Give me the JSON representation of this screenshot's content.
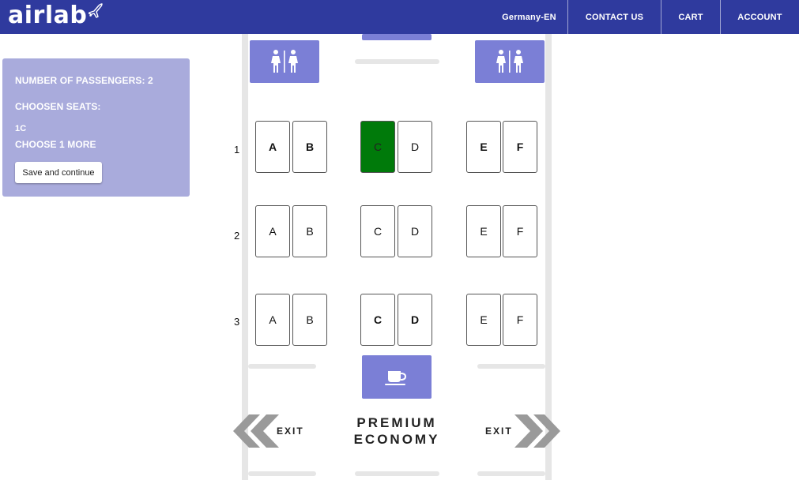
{
  "header": {
    "logo": "airlab",
    "nav": {
      "language": "Germany-EN",
      "contact": "CONTACT US",
      "cart": "CART",
      "account": "ACCOUNT"
    }
  },
  "panel": {
    "passengers": "NUMBER OF PASSENGERS: 2",
    "chosen_label": "CHOOSEN SEATS:",
    "chosen_seat": "1C",
    "choose_more": "CHOOSE 1 MORE",
    "save_button": "Save and continue"
  },
  "seat_map": {
    "rows": [
      {
        "number": "1",
        "seats": [
          "A",
          "B",
          "C",
          "D",
          "E",
          "F"
        ]
      },
      {
        "number": "2",
        "seats": [
          "A",
          "B",
          "C",
          "D",
          "E",
          "F"
        ]
      },
      {
        "number": "3",
        "seats": [
          "A",
          "B",
          "C",
          "D",
          "E",
          "F"
        ]
      }
    ],
    "selected_seat": "1C",
    "exit_left": "EXIT",
    "exit_right": "EXIT",
    "cabin_class_line1": "PREMIUM",
    "cabin_class_line2": "ECONOMY"
  },
  "colors": {
    "header_bg": "#2f3a9e",
    "panel_bg": "#a9abdc",
    "facility_bg": "#7b7fd6",
    "selected_seat": "#007a0a",
    "exit_chevron": "#9a9a9a"
  },
  "icons": [
    "airplane-icon",
    "restroom-icon",
    "coffee-cup-icon",
    "exit-chevron-left-icon",
    "exit-chevron-right-icon"
  ]
}
